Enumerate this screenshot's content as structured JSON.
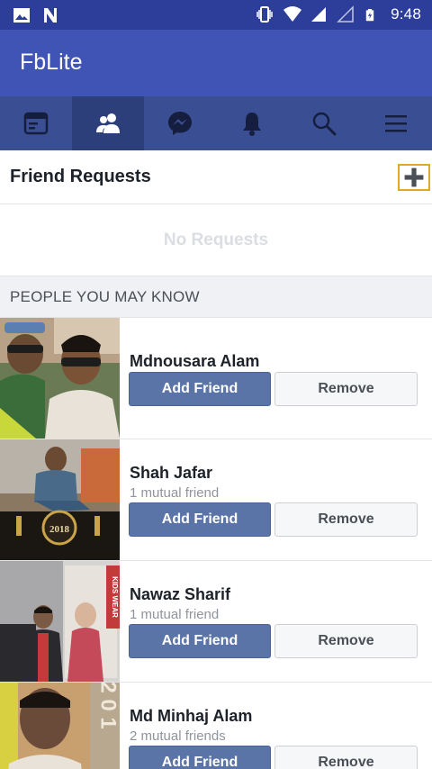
{
  "status_bar": {
    "time": "9:48",
    "icons": [
      "image-icon",
      "n-icon",
      "vibrate-icon",
      "wifi-icon",
      "signal-icon",
      "signal-empty-icon",
      "battery-charging-icon"
    ]
  },
  "app": {
    "title": "FbLite"
  },
  "tabs": [
    {
      "name": "news-feed",
      "icon": "news-feed-icon",
      "active": false
    },
    {
      "name": "friends",
      "icon": "friends-icon",
      "active": true
    },
    {
      "name": "messenger",
      "icon": "messenger-icon",
      "active": false
    },
    {
      "name": "notifications",
      "icon": "bell-icon",
      "active": false
    },
    {
      "name": "search",
      "icon": "search-icon",
      "active": false
    },
    {
      "name": "menu",
      "icon": "menu-icon",
      "active": false
    }
  ],
  "friend_requests": {
    "title": "Friend Requests",
    "empty_text": "No Requests"
  },
  "pymk": {
    "title": "PEOPLE YOU MAY KNOW",
    "people": [
      {
        "name": "Mdnousara Alam",
        "mutual": "",
        "add_label": "Add Friend",
        "remove_label": "Remove"
      },
      {
        "name": "Shah Jafar",
        "mutual": "1 mutual friend",
        "add_label": "Add Friend",
        "remove_label": "Remove"
      },
      {
        "name": "Nawaz Sharif",
        "mutual": "1 mutual friend",
        "add_label": "Add Friend",
        "remove_label": "Remove"
      },
      {
        "name": "Md Minhaj Alam",
        "mutual": "2 mutual friends",
        "add_label": "Add Friend",
        "remove_label": "Remove"
      }
    ]
  },
  "photo_text": {
    "badge_2018": "2018",
    "kids_wear": "KIDS WEAR",
    "year_digits": "2 0 1"
  },
  "colors": {
    "status_bar": "#2d3e9a",
    "app_bar": "#4054b5",
    "tab_bar": "#3a4f93",
    "tab_active": "#2d3f7a",
    "add_friend": "#5b74a8"
  }
}
